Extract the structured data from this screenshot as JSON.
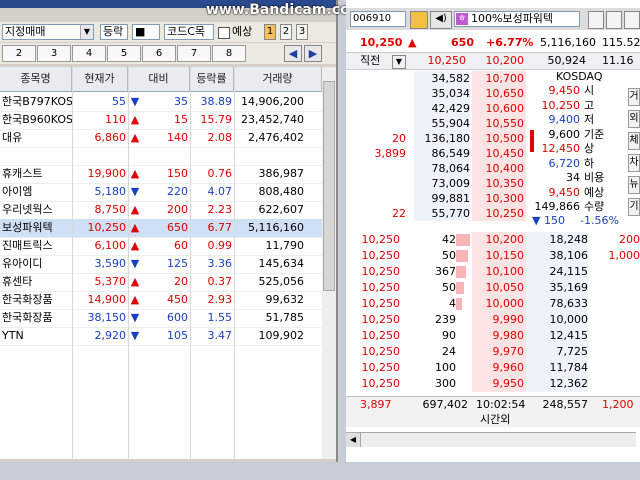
{
  "watermark": "www.Bandicam.com",
  "left": {
    "mode_combo": "지정매매",
    "filter_combo": "등락",
    "code_label": "코드C목",
    "forecast_label": "예상",
    "num_tabs": [
      "1",
      "2",
      "3"
    ],
    "page_tabs": [
      "2",
      "3",
      "4",
      "5",
      "6",
      "7",
      "8"
    ],
    "columns": [
      "종목명",
      "현재가",
      "대비",
      "등락률",
      "거래량"
    ],
    "rows": [
      {
        "name": "한국B797KOS",
        "price": "55",
        "arrow": "▼",
        "diff": "35",
        "rate": "38.89",
        "volume": "14,906,200",
        "dir": "dn"
      },
      {
        "name": "한국B960KOS",
        "price": "110",
        "arrow": "▲",
        "diff": "15",
        "rate": "15.79",
        "volume": "23,452,740",
        "dir": "up"
      },
      {
        "name": "대유",
        "price": "6,860",
        "arrow": "▲",
        "diff": "140",
        "rate": "2.08",
        "volume": "2,476,402",
        "dir": "up"
      },
      {
        "name": "",
        "price": "",
        "arrow": "",
        "diff": "",
        "rate": "",
        "volume": "",
        "dir": "dk"
      },
      {
        "name": "휴캐스트",
        "price": "19,900",
        "arrow": "▲",
        "diff": "150",
        "rate": "0.76",
        "volume": "386,987",
        "dir": "up"
      },
      {
        "name": "아이엠",
        "price": "5,180",
        "arrow": "▼",
        "diff": "220",
        "rate": "4.07",
        "volume": "808,480",
        "dir": "dn"
      },
      {
        "name": "우리넷웍스",
        "price": "8,750",
        "arrow": "▲",
        "diff": "200",
        "rate": "2.23",
        "volume": "622,607",
        "dir": "up"
      },
      {
        "name": "보성파워텍",
        "price": "10,250",
        "arrow": "▲",
        "diff": "650",
        "rate": "6.77",
        "volume": "5,116,160",
        "dir": "up"
      },
      {
        "name": "진매트릭스",
        "price": "6,100",
        "arrow": "▲",
        "diff": "60",
        "rate": "0.99",
        "volume": "11,790",
        "dir": "up"
      },
      {
        "name": "유아이디",
        "price": "3,590",
        "arrow": "▼",
        "diff": "125",
        "rate": "3.36",
        "volume": "145,634",
        "dir": "dn"
      },
      {
        "name": "휴센타",
        "price": "5,370",
        "arrow": "▲",
        "diff": "20",
        "rate": "0.37",
        "volume": "525,056",
        "dir": "up"
      },
      {
        "name": "한국화장품",
        "price": "14,900",
        "arrow": "▲",
        "diff": "450",
        "rate": "2.93",
        "volume": "99,632",
        "dir": "up"
      },
      {
        "name": "한국화장품",
        "price": "38,150",
        "arrow": "▼",
        "diff": "600",
        "rate": "1.55",
        "volume": "51,785",
        "dir": "dn"
      },
      {
        "name": "YTN",
        "price": "2,920",
        "arrow": "▼",
        "diff": "105",
        "rate": "3.47",
        "volume": "109,902",
        "dir": "dn"
      }
    ],
    "selected_row": 7
  },
  "right": {
    "code": "006910",
    "stock_name": "100%보성파워텍",
    "price": "10,250",
    "price_arrow": "▲",
    "diff": "650",
    "rate": "+6.77%",
    "volume": "5,116,160",
    "extra": "115.52",
    "sub_label": "직전",
    "sub_price1": "10,250",
    "sub_price2": "10,200",
    "sub_vol": "50,924",
    "sub_extra": "11.16",
    "asks": [
      {
        "bq": "",
        "aq": "34,582",
        "price": "10,700"
      },
      {
        "bq": "",
        "aq": "35,034",
        "price": "10,650"
      },
      {
        "bq": "",
        "aq": "42,429",
        "price": "10,600"
      },
      {
        "bq": "",
        "aq": "55,904",
        "price": "10,550"
      },
      {
        "bq": "20",
        "aq": "136,180",
        "price": "10,500"
      },
      {
        "bq": "3,899",
        "aq": "86,549",
        "price": "10,450"
      },
      {
        "bq": "",
        "aq": "78,064",
        "price": "10,400"
      },
      {
        "bq": "",
        "aq": "73,009",
        "price": "10,350"
      },
      {
        "bq": "",
        "aq": "99,881",
        "price": "10,300"
      },
      {
        "bq": "22",
        "aq": "55,770",
        "price": "10,250"
      }
    ],
    "kosdaq": {
      "title": "KOSDAQ",
      "items": [
        {
          "v": "9,450",
          "k": "시"
        },
        {
          "v": "10,250",
          "k": "고"
        },
        {
          "v": "9,400",
          "k": "저"
        },
        {
          "v": "9,600",
          "k": "기준"
        },
        {
          "v": "12,450",
          "k": "상"
        },
        {
          "v": "6,720",
          "k": "하"
        },
        {
          "v": "34",
          "k": "비용"
        },
        {
          "v": "9,450",
          "k": "예상"
        },
        {
          "v": "149,866",
          "k": "수량"
        }
      ],
      "chg_arrow": "▼",
      "chg_val": "150",
      "chg_rate": "-1.56%"
    },
    "trades": [
      {
        "t": "10,250",
        "q": "42",
        "p": "10,200",
        "b": "18,248",
        "e": "200"
      },
      {
        "t": "10,250",
        "q": "50",
        "p": "10,150",
        "b": "38,106",
        "e": "1,000"
      },
      {
        "t": "10,250",
        "q": "367",
        "p": "10,100",
        "b": "24,115",
        "e": ""
      },
      {
        "t": "10,250",
        "q": "50",
        "p": "10,050",
        "b": "35,169",
        "e": ""
      },
      {
        "t": "10,250",
        "q": "4",
        "p": "10,000",
        "b": "78,633",
        "e": ""
      },
      {
        "t": "10,250",
        "q": "239",
        "p": "9,990",
        "b": "10,000",
        "e": ""
      },
      {
        "t": "10,250",
        "q": "90",
        "p": "9,980",
        "b": "12,415",
        "e": ""
      },
      {
        "t": "10,250",
        "q": "24",
        "p": "9,970",
        "b": "7,725",
        "e": ""
      },
      {
        "t": "10,250",
        "q": "100",
        "p": "9,960",
        "b": "11,784",
        "e": ""
      },
      {
        "t": "10,250",
        "q": "300",
        "p": "9,950",
        "b": "12,362",
        "e": ""
      }
    ],
    "footer": {
      "left": "3,897",
      "total_ask": "697,402",
      "time": "10:02:54",
      "total_bid": "248,557",
      "right": "1,200",
      "after_hours": "시간외"
    },
    "side_buttons": [
      "거",
      "외",
      "체",
      "차",
      "뉴",
      "기"
    ]
  }
}
